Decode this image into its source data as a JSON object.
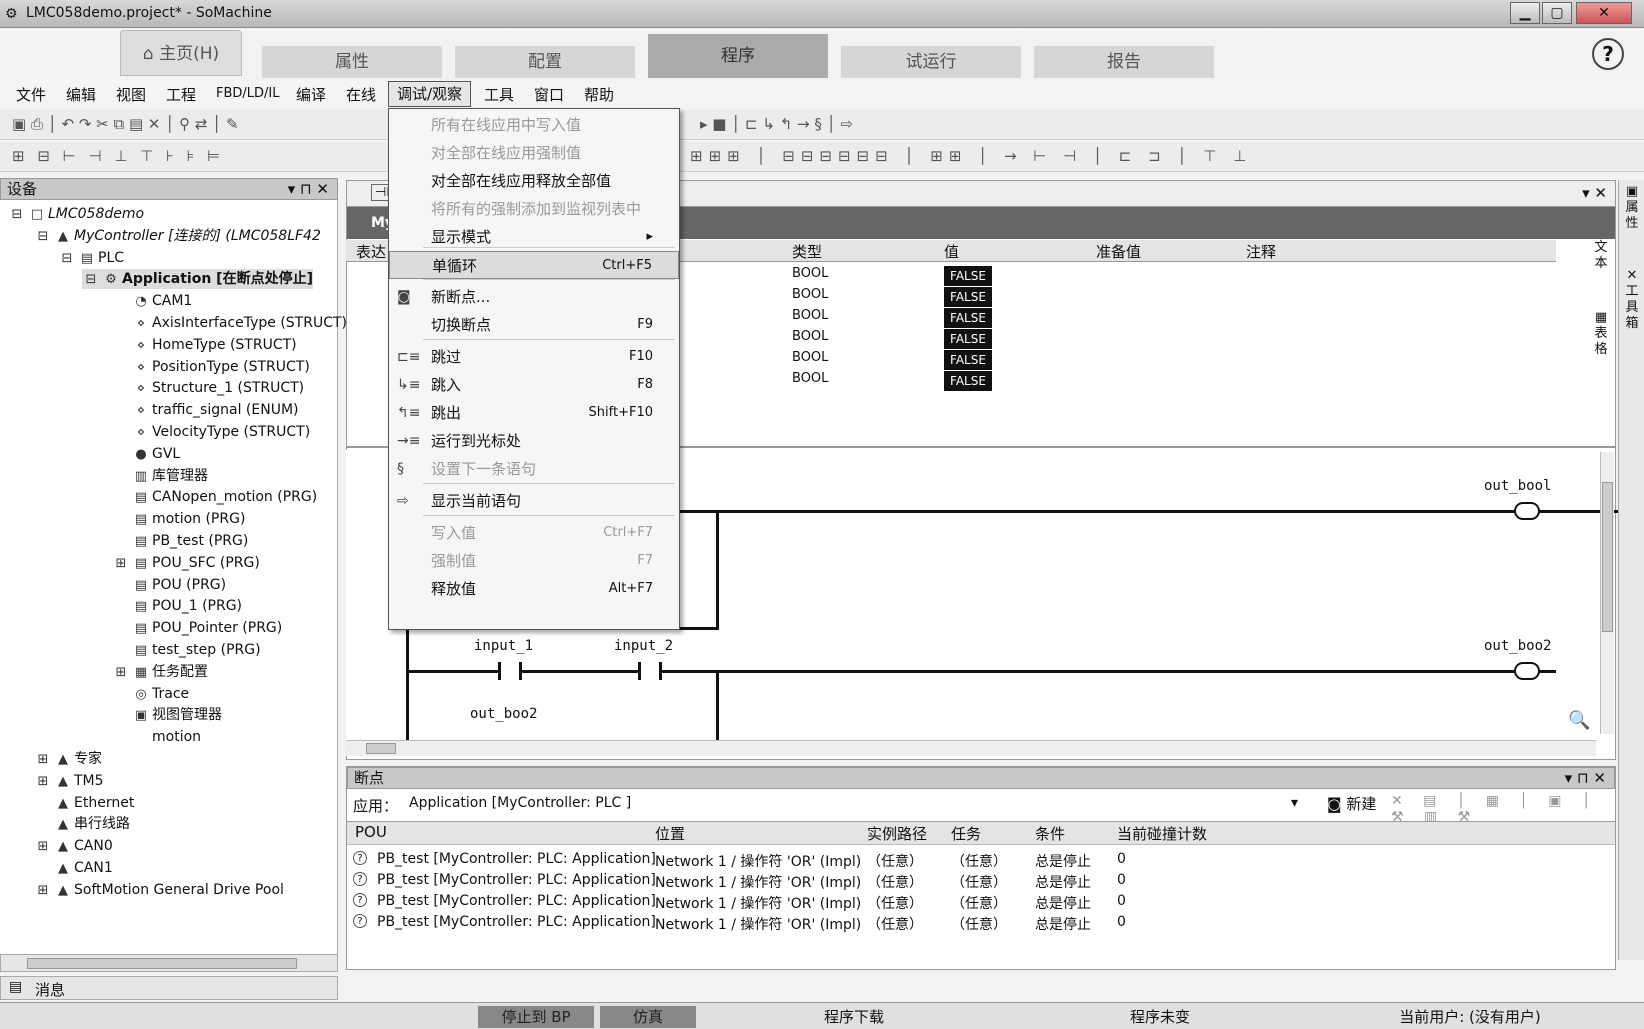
{
  "window": {
    "title": "LMC058demo.project* - SoMachine",
    "min": "▁",
    "max": "▢",
    "close": "✕"
  },
  "ribbon": {
    "home": "⌂ 主页(H)",
    "tabs": [
      "属性",
      "配置",
      "程序",
      "试运行",
      "报告"
    ],
    "active": "程序",
    "help": "?"
  },
  "menu": [
    "文件",
    "编辑",
    "视图",
    "工程",
    "FBD/LD/IL",
    "编译",
    "在线",
    "调试/观察",
    "工具",
    "窗口",
    "帮助"
  ],
  "device_panel": {
    "title": "设备",
    "pin": "▾ ⊓ ✕"
  },
  "tree": [
    {
      "label": "LMC058demo",
      "indent": 0,
      "icon": "□",
      "exp": "⊟"
    },
    {
      "label": "MyController [连接的] (LMC058LF42",
      "indent": 1,
      "icon": "▲",
      "exp": "⊟"
    },
    {
      "label": "PLC",
      "indent": 2,
      "icon": "▤",
      "exp": "⊟"
    },
    {
      "label": "Application [在断点处停止]",
      "indent": 3,
      "icon": "⚙",
      "exp": "⊟",
      "bold": true
    },
    {
      "label": "CAM1",
      "indent": 4,
      "icon": "◔"
    },
    {
      "label": "AxisInterfaceType (STRUCT)",
      "indent": 4,
      "icon": "⋄"
    },
    {
      "label": "HomeType (STRUCT)",
      "indent": 4,
      "icon": "⋄"
    },
    {
      "label": "PositionType (STRUCT)",
      "indent": 4,
      "icon": "⋄"
    },
    {
      "label": "Structure_1 (STRUCT)",
      "indent": 4,
      "icon": "⋄"
    },
    {
      "label": "traffic_signal (ENUM)",
      "indent": 4,
      "icon": "⋄"
    },
    {
      "label": "VelocityType (STRUCT)",
      "indent": 4,
      "icon": "⋄"
    },
    {
      "label": "GVL",
      "indent": 4,
      "icon": "●"
    },
    {
      "label": "库管理器",
      "indent": 4,
      "icon": "▥"
    },
    {
      "label": "CANopen_motion (PRG)",
      "indent": 4,
      "icon": "▤"
    },
    {
      "label": "motion (PRG)",
      "indent": 4,
      "icon": "▤"
    },
    {
      "label": "PB_test (PRG)",
      "indent": 4,
      "icon": "▤"
    },
    {
      "label": "POU_SFC (PRG)",
      "indent": 4,
      "icon": "▤",
      "exp": "⊞"
    },
    {
      "label": "POU (PRG)",
      "indent": 4,
      "icon": "▤"
    },
    {
      "label": "POU_1 (PRG)",
      "indent": 4,
      "icon": "▤"
    },
    {
      "label": "POU_Pointer (PRG)",
      "indent": 4,
      "icon": "▤"
    },
    {
      "label": "test_step (PRG)",
      "indent": 4,
      "icon": "▤"
    },
    {
      "label": "任务配置",
      "indent": 4,
      "icon": "▦",
      "exp": "⊞"
    },
    {
      "label": "Trace",
      "indent": 4,
      "icon": "◎"
    },
    {
      "label": "视图管理器",
      "indent": 4,
      "icon": "▣"
    },
    {
      "label": "motion",
      "indent": 4,
      "icon": " "
    },
    {
      "label": "专家",
      "indent": 1,
      "icon": "▲",
      "exp": "⊞"
    },
    {
      "label": "TM5",
      "indent": 1,
      "icon": "▲",
      "exp": "⊞"
    },
    {
      "label": "Ethernet",
      "indent": 1,
      "icon": "▲"
    },
    {
      "label": "串行线路",
      "indent": 1,
      "icon": "▲"
    },
    {
      "label": "CAN0",
      "indent": 1,
      "icon": "▲",
      "exp": "⊞"
    },
    {
      "label": "CAN1",
      "indent": 1,
      "icon": "▲"
    },
    {
      "label": "SoftMotion General Drive Pool",
      "indent": 1,
      "icon": "▲",
      "exp": "⊞"
    }
  ],
  "editor": {
    "header_left": "表达",
    "header_strip": "My",
    "columns": [
      "类型",
      "值",
      "准备值",
      "注释"
    ],
    "rows": [
      {
        "type": "BOOL",
        "value": "FALSE"
      },
      {
        "type": "BOOL",
        "value": "FALSE"
      },
      {
        "type": "BOOL",
        "value": "FALSE"
      },
      {
        "type": "BOOL",
        "value": "FALSE"
      },
      {
        "type": "BOOL",
        "value": "FALSE"
      },
      {
        "type": "BOOL",
        "value": "FALSE"
      }
    ],
    "close": "▾ ✕"
  },
  "ladder": {
    "coil1": "out_bool",
    "coil2": "out_boo2",
    "contact1": "input_1",
    "contact2": "input_2",
    "contact3": "out_boo2"
  },
  "dropdown": [
    {
      "label": "所有在线应用中写入值",
      "sc": "",
      "dis": true,
      "icon": ""
    },
    {
      "label": "对全部在线应用强制值",
      "sc": "",
      "dis": true,
      "icon": ""
    },
    {
      "label": "对全部在线应用释放全部值",
      "sc": "",
      "dis": false,
      "icon": ""
    },
    {
      "label": "将所有的强制添加到监视列表中",
      "sc": "",
      "dis": true,
      "icon": ""
    },
    {
      "label": "显示模式",
      "sc": "▸",
      "dis": false,
      "icon": ""
    },
    {
      "label": "单循环",
      "sc": "Ctrl+F5",
      "dis": false,
      "icon": "",
      "hl": true
    },
    {
      "label": "新断点...",
      "sc": "",
      "dis": false,
      "icon": "◙"
    },
    {
      "label": "切换断点",
      "sc": "F9",
      "dis": false,
      "icon": ""
    },
    {
      "label": "跳过",
      "sc": "F10",
      "dis": false,
      "icon": "⊏≡"
    },
    {
      "label": "跳入",
      "sc": "F8",
      "dis": false,
      "icon": "↳≡"
    },
    {
      "label": "跳出",
      "sc": "Shift+F10",
      "dis": false,
      "icon": "↰≡"
    },
    {
      "label": "运行到光标处",
      "sc": "",
      "dis": false,
      "icon": "→≡"
    },
    {
      "label": "设置下一条语句",
      "sc": "",
      "dis": true,
      "icon": "§"
    },
    {
      "label": "显示当前语句",
      "sc": "",
      "dis": false,
      "icon": "⇨"
    },
    {
      "label": "写入值",
      "sc": "Ctrl+F7",
      "dis": true,
      "icon": ""
    },
    {
      "label": "强制值",
      "sc": "F7",
      "dis": true,
      "icon": ""
    },
    {
      "label": "释放值",
      "sc": "Alt+F7",
      "dis": false,
      "icon": ""
    }
  ],
  "breakpoints": {
    "title": "断点",
    "app_label": "应用：",
    "app_value": "Application [MyController: PLC ]",
    "new_btn": "新建",
    "columns": [
      "POU",
      "位置",
      "实例路径",
      "任务",
      "条件",
      "当前碰撞计数"
    ],
    "rows": [
      {
        "pou": "PB_test [MyController: PLC: Application]",
        "pos": "Network 1 / 操作符 'OR' (Impl)",
        "inst": "（任意）",
        "task": "（任意）",
        "cond": "总是停止",
        "count": "0"
      },
      {
        "pou": "PB_test [MyController: PLC: Application]",
        "pos": "Network 1 / 操作符 'OR' (Impl)",
        "inst": "（任意）",
        "task": "（任意）",
        "cond": "总是停止",
        "count": "0"
      },
      {
        "pou": "PB_test [MyController: PLC: Application]",
        "pos": "Network 1 / 操作符 'OR' (Impl)",
        "inst": "（任意）",
        "task": "（任意）",
        "cond": "总是停止",
        "count": "0"
      },
      {
        "pou": "PB_test [MyController: PLC: Application]",
        "pos": "Network 1 / 操作符 'OR' (Impl)",
        "inst": "（任意）",
        "task": "（任意）",
        "cond": "总是停止",
        "count": "0"
      }
    ]
  },
  "messages": "消息",
  "status": {
    "stop": "停止到 BP",
    "sim": "仿真",
    "download": "程序下载",
    "unchanged": "程序未变",
    "user": "当前用户: (没有用户)"
  },
  "side": {
    "a": "属性",
    "b": "工具箱",
    "c": "文本",
    "d": "表格"
  }
}
